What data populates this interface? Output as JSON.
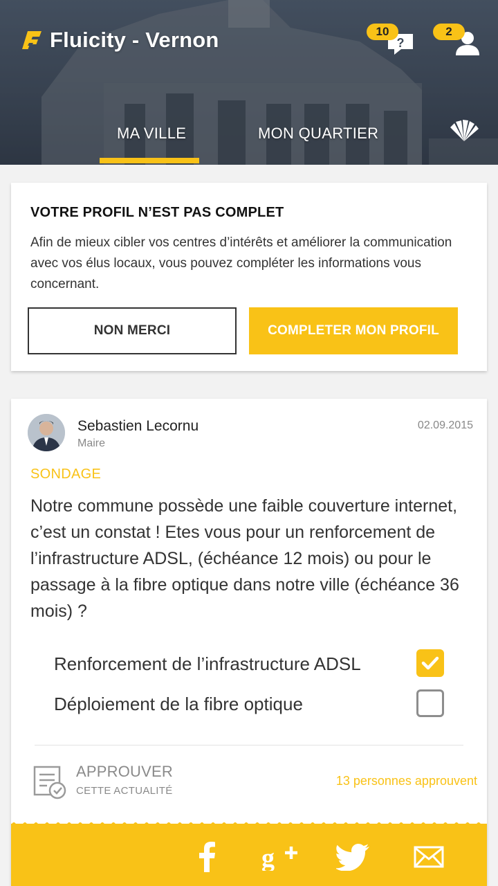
{
  "header": {
    "app_title": "Fluicity - Vernon",
    "messages_badge": "10",
    "profile_badge": "2",
    "tabs": [
      {
        "label": "MA VILLE",
        "active": true
      },
      {
        "label": "MON QUARTIER",
        "active": false
      }
    ],
    "icons": {
      "logo": "fluicity-logo-icon",
      "messages": "question-bubble-icon",
      "profile": "user-icon",
      "fan": "fan-icon"
    }
  },
  "profile_card": {
    "title": "VOTRE PROFIL N’EST PAS COMPLET",
    "text": "Afin de mieux cibler vos centres d’intérêts et améliorer la communication avec vos élus locaux, vous pouvez compléter les informations vous concernant.",
    "decline_label": "NON MERCI",
    "complete_label": "COMPLETER MON PROFIL"
  },
  "post": {
    "author_name": "Sebastien Lecornu",
    "author_role": "Maire",
    "date": "02.09.2015",
    "kind": "SONDAGE",
    "body": "Notre commune possède une faible couverture internet, c’est un constat ! Etes vous pour un renforcement de l’infrastructure ADSL, (échéance 12 mois) ou pour le passage à la fibre optique dans notre ville (échéance 36 mois) ?",
    "options": [
      {
        "label": "Renforcement de l’infrastructure ADSL",
        "checked": true
      },
      {
        "label": "Déploiement de la fibre optique",
        "checked": false
      }
    ],
    "approve_label": "APPROUVER",
    "approve_sub": "CETTE ACTUALITÉ",
    "approve_count": "13 personnes approuvent",
    "share_icons": [
      "facebook-icon",
      "google-plus-icon",
      "twitter-icon",
      "email-icon"
    ]
  },
  "colors": {
    "accent": "#f9c217",
    "header_bg": "#3f4a59",
    "text": "#333333",
    "muted": "#888888"
  }
}
